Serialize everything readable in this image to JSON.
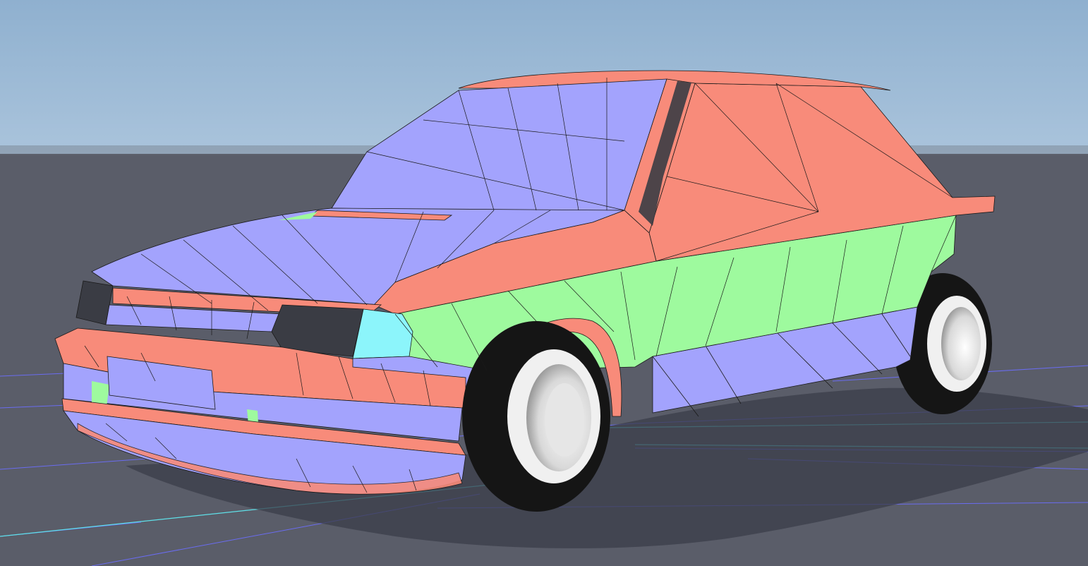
{
  "viewport": {
    "colors": {
      "sky_top": "#8fb0cf",
      "sky_bottom": "#aac4dc",
      "ground": "#5a5d69",
      "ground_far": "#646774",
      "grid_line": "#6a6cf0",
      "grid_axis": "#5fe0e8",
      "shadow": "#3b3e4a",
      "mat_blue": "#a3a3fd",
      "mat_red": "#f88b7a",
      "mat_green": "#9efa9e",
      "mat_cyan": "#8cf5fb",
      "tire": "#151515",
      "rim": "#f0f0f0",
      "cavity": "#3a3c44",
      "wire": "#1a1a1a"
    },
    "model": {
      "object": "hatchback-car",
      "display_mode": "wireframe-on-shaded",
      "materials": [
        "blue",
        "red",
        "green",
        "cyan"
      ]
    }
  }
}
